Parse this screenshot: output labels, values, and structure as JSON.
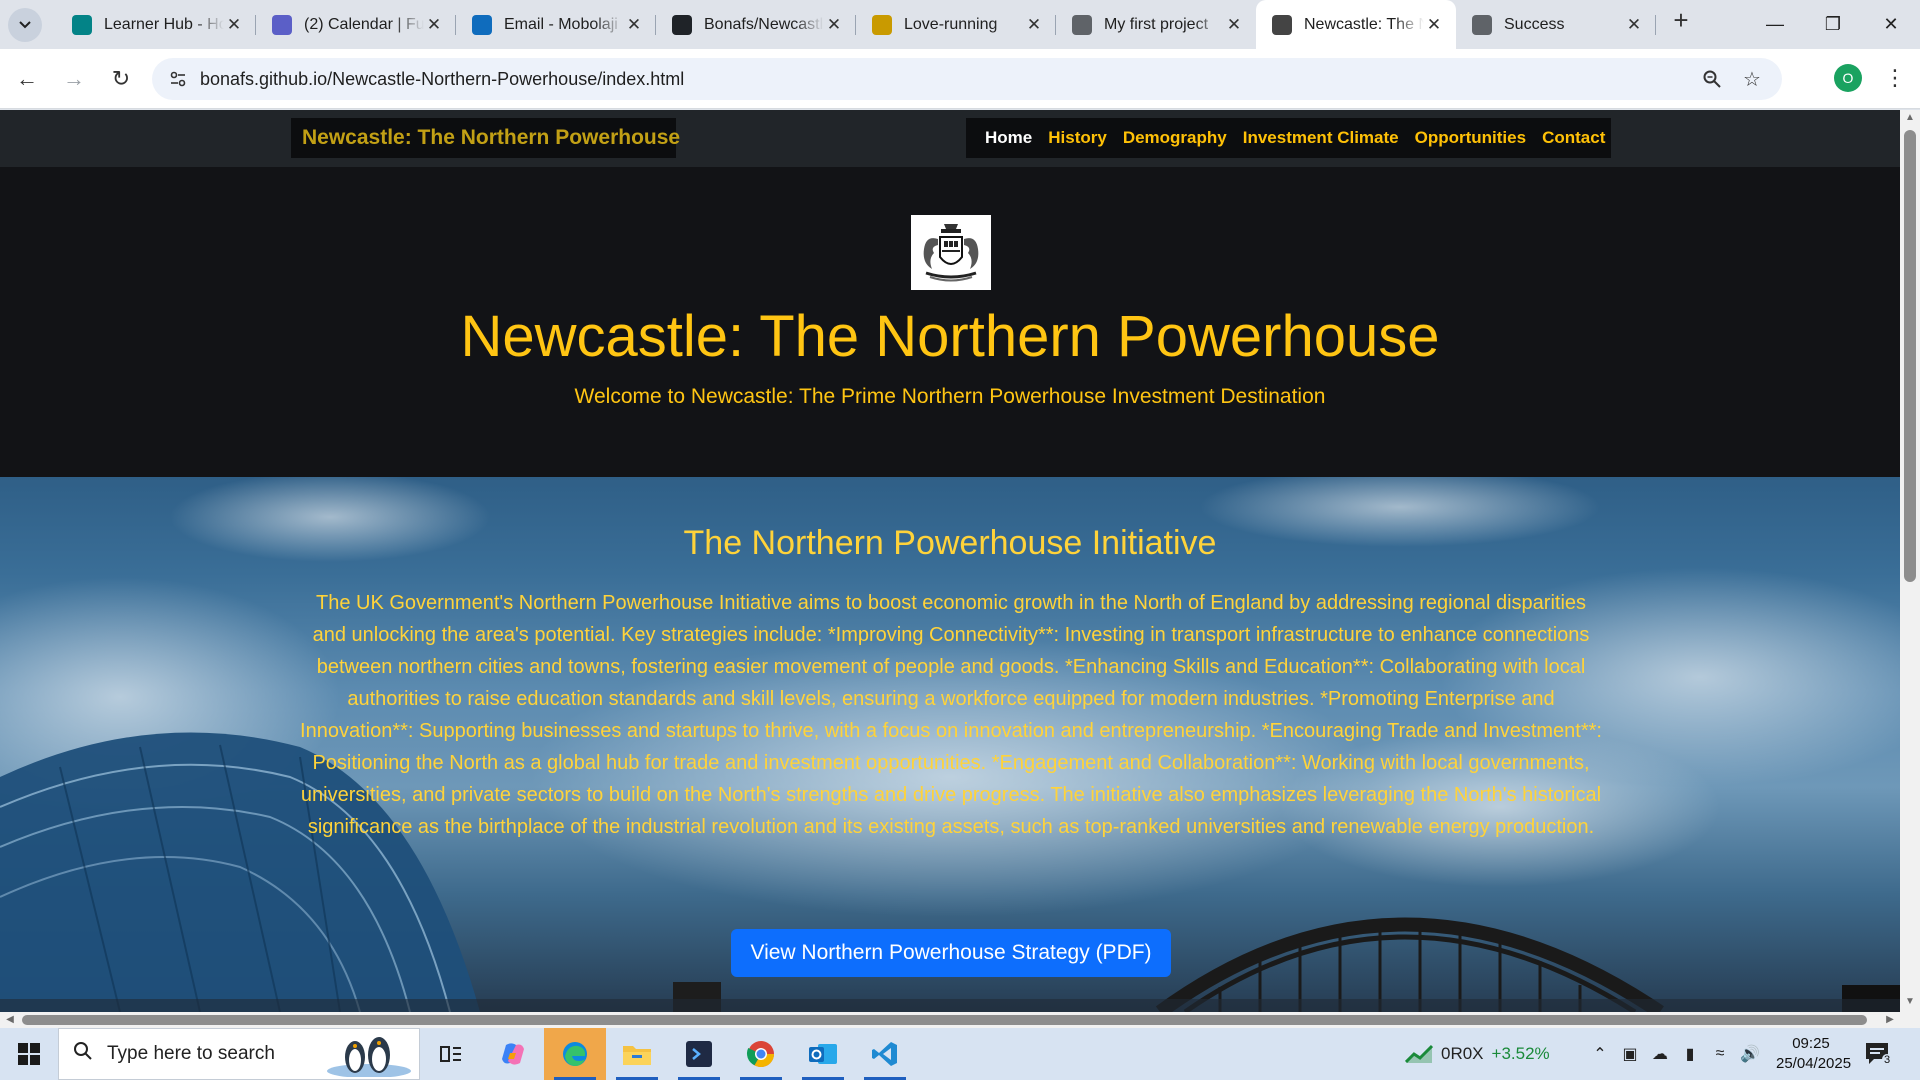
{
  "browser": {
    "tabs": [
      {
        "title": "Learner Hub - Ho",
        "favicon": "sharepoint-icon",
        "color": "#038387"
      },
      {
        "title": "(2) Calendar | Fu",
        "favicon": "teams-icon",
        "color": "#5b5fc7"
      },
      {
        "title": "Email - Mobolaji",
        "favicon": "outlook-icon",
        "color": "#0f6cbd"
      },
      {
        "title": "Bonafs/Newcastl",
        "favicon": "github-icon",
        "color": "#1f2328"
      },
      {
        "title": "Love-running",
        "favicon": "runner-icon",
        "color": "#c99a00"
      },
      {
        "title": "My first project",
        "favicon": "globe-icon",
        "color": "#5f6368"
      },
      {
        "title": "Newcastle: The N",
        "favicon": "crest-icon",
        "color": "#444444",
        "active": true
      },
      {
        "title": "Success",
        "favicon": "globe-icon",
        "color": "#5f6368"
      }
    ],
    "url": "bonafs.github.io/Newcastle-Northern-Powerhouse/index.html",
    "profile_initial": "O"
  },
  "site": {
    "brand": "Newcastle: The Northern Powerhouse",
    "nav": [
      "Home",
      "History",
      "Demography",
      "Investment Climate",
      "Opportunities",
      "Contact"
    ],
    "hero_title": "Newcastle: The Northern Powerhouse",
    "hero_lead": "Welcome to Newcastle: The Prime Northern Powerhouse Investment Destination",
    "section_title": "The Northern Powerhouse Initiative",
    "section_body": "The UK Government's Northern Powerhouse Initiative aims to boost economic growth in the North of England by addressing regional disparities and unlocking the area's potential. Key strategies include: *Improving Connectivity**: Investing in transport infrastructure to enhance connections between northern cities and towns, fostering easier movement of people and goods. *Enhancing Skills and Education**: Collaborating with local authorities to raise education standards and skill levels, ensuring a workforce equipped for modern industries. *Promoting Enterprise and Innovation**: Supporting businesses and startups to thrive, with a focus on innovation and entrepreneurship. *Encouraging Trade and Investment**: Positioning the North as a global hub for trade and investment opportunities. *Engagement and Collaboration**: Working with local governments, universities, and private sectors to build on the North's strengths and drive progress. The initiative also emphasizes leveraging the North's historical significance as the birthplace of the industrial revolution and its existing assets, such as top-ranked universities and renewable energy production.",
    "pdf_button": "View Northern Powerhouse Strategy (PDF)",
    "colors": {
      "accent_gold": "#ffc513",
      "nav_bg": "#212529",
      "button_blue": "#0d6efd"
    }
  },
  "taskbar": {
    "search_placeholder": "Type here to search",
    "stock_ticker": "0R0X",
    "stock_change": "+3.52%",
    "time": "09:25",
    "date": "25/04/2025",
    "notification_count": "3"
  }
}
